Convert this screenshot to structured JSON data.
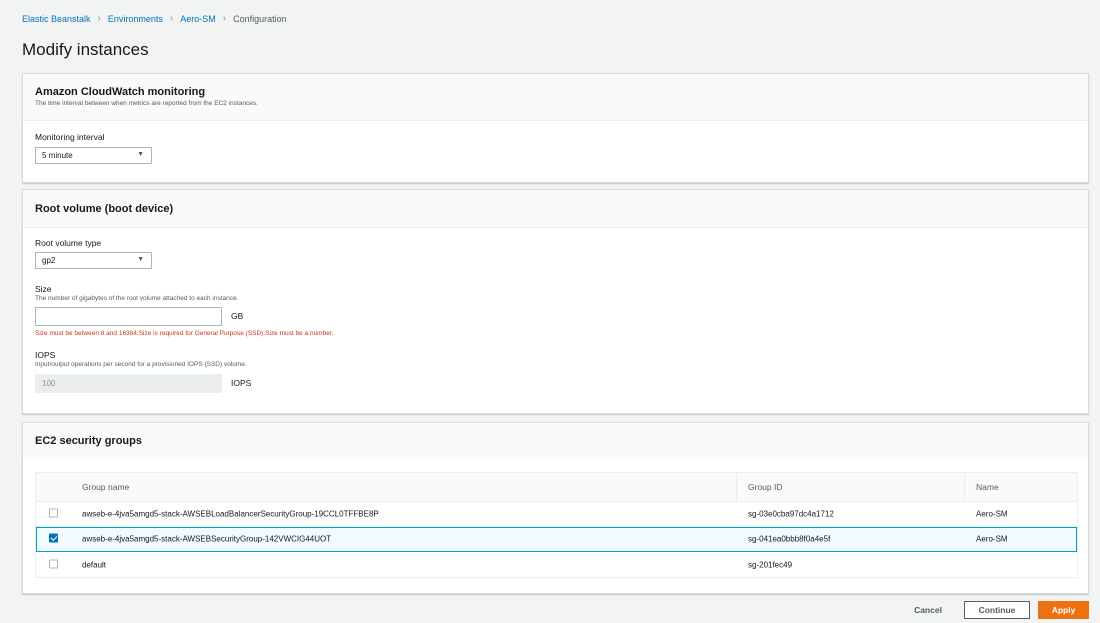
{
  "breadcrumb": {
    "items": [
      "Elastic Beanstalk",
      "Environments",
      "Aero-SM"
    ],
    "current": "Configuration"
  },
  "page_title": "Modify instances",
  "cloudwatch": {
    "title": "Amazon CloudWatch monitoring",
    "description": "The time interval between when metrics are reported from the EC2 instances.",
    "interval_label": "Monitoring interval",
    "interval_value": "5 minute"
  },
  "root_volume": {
    "title": "Root volume (boot device)",
    "type_label": "Root volume type",
    "type_value": "gp2",
    "size_label": "Size",
    "size_description": "The number of gigabytes of the root volume attached to each instance.",
    "size_value": "",
    "size_unit": "GB",
    "size_error": "Size must be between 8 and 16384.Size is required for General Purpose (SSD).Size must be a number.",
    "iops_label": "IOPS",
    "iops_description": "Input/output operations per second for a provisioned IOPS (SSD) volume.",
    "iops_value": "100",
    "iops_unit": "IOPS"
  },
  "security_groups": {
    "title": "EC2 security groups",
    "columns": [
      "Group name",
      "Group ID",
      "Name"
    ],
    "rows": [
      {
        "checked": false,
        "group_name": "awseb-e-4jva5amgd5-stack-AWSEBLoadBalancerSecurityGroup-19CCL0TFFBE8P",
        "group_id": "sg-03e0cba97dc4a1712",
        "name": "Aero-SM"
      },
      {
        "checked": true,
        "group_name": "awseb-e-4jva5amgd5-stack-AWSEBSecurityGroup-142VWCIG44UOT",
        "group_id": "sg-041ea0bbb8f0a4e5f",
        "name": "Aero-SM"
      },
      {
        "checked": false,
        "group_name": "default",
        "group_id": "sg-201fec49",
        "name": ""
      }
    ]
  },
  "footer": {
    "cancel_label": "Cancel",
    "continue_label": "Continue",
    "apply_label": "Apply"
  },
  "colors": {
    "link": "#0073bb",
    "primary": "#ec7211",
    "error": "#d13212",
    "selected_row": "#f1faff"
  }
}
